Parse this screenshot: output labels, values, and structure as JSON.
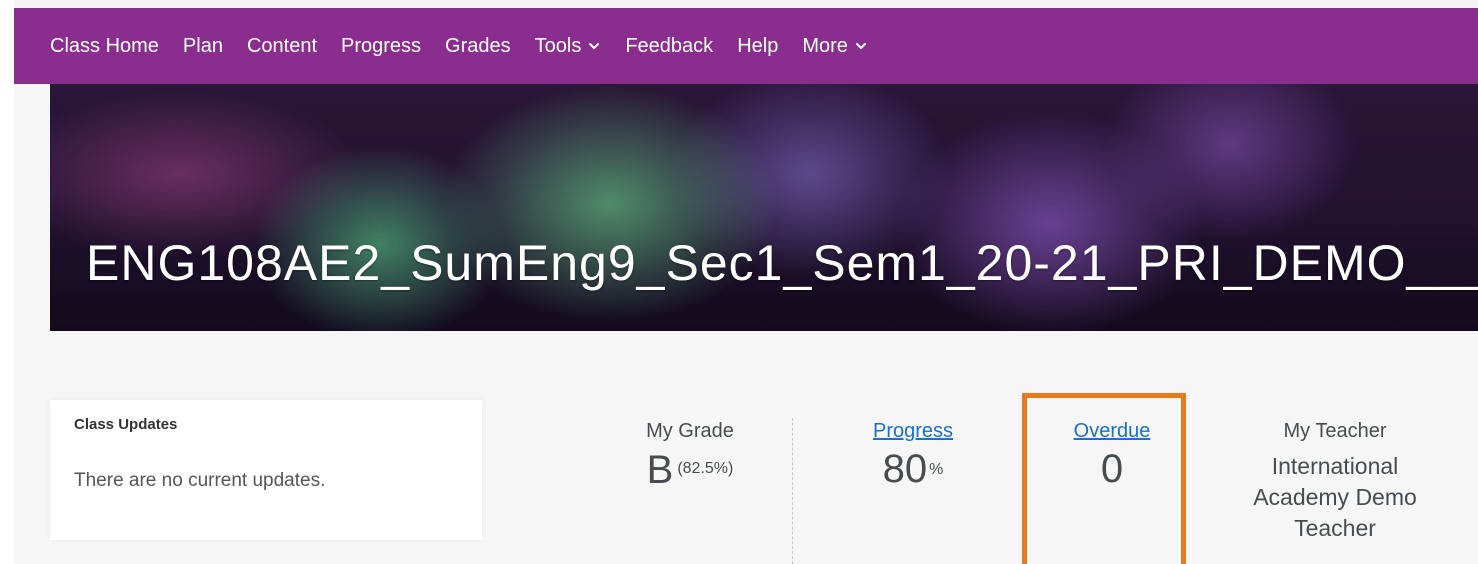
{
  "nav": {
    "items": [
      {
        "label": "Class Home",
        "dropdown": false
      },
      {
        "label": "Plan",
        "dropdown": false
      },
      {
        "label": "Content",
        "dropdown": false
      },
      {
        "label": "Progress",
        "dropdown": false
      },
      {
        "label": "Grades",
        "dropdown": false
      },
      {
        "label": "Tools",
        "dropdown": true
      },
      {
        "label": "Feedback",
        "dropdown": false
      },
      {
        "label": "Help",
        "dropdown": false
      },
      {
        "label": "More",
        "dropdown": true
      }
    ],
    "background": "#8a2d8e"
  },
  "banner": {
    "course_title": "ENG108AE2_SumEng9_Sec1_Sem1_20-21_PRI_DEMO____"
  },
  "updates": {
    "title": "Class Updates",
    "message": "There are no current updates."
  },
  "stats": {
    "grade": {
      "label": "My Grade",
      "value": "B",
      "detail": "(82.5%)"
    },
    "progress": {
      "label": "Progress",
      "value": "80",
      "unit": "%"
    },
    "overdue": {
      "label": "Overdue",
      "value": "0"
    },
    "teacher": {
      "label": "My Teacher",
      "name_lines": [
        "International",
        "Academy Demo",
        "Teacher"
      ]
    }
  },
  "colors": {
    "link": "#1a6fd0",
    "highlight": "#e57a1f"
  }
}
